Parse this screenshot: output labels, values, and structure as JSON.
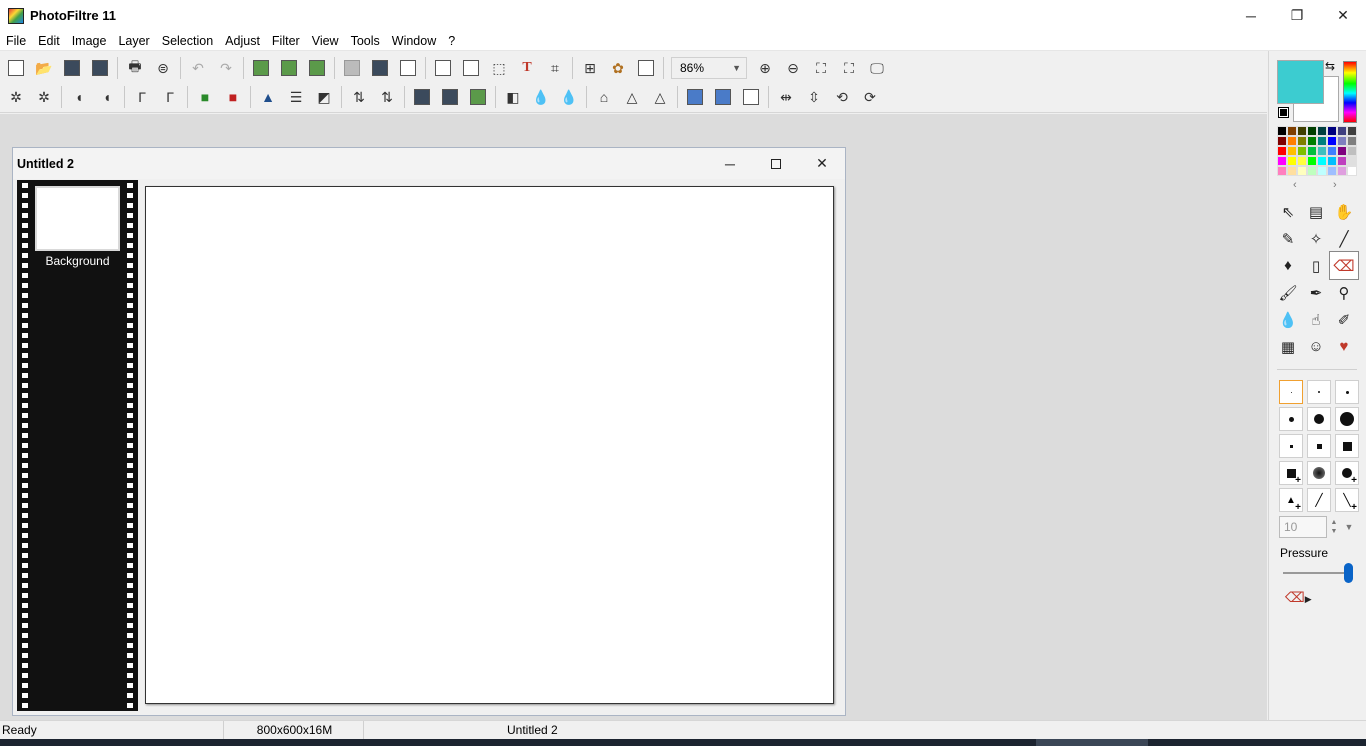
{
  "app": {
    "title": "PhotoFiltre 11"
  },
  "window_controls": {
    "minimize": "─",
    "maximize": "❐",
    "close": "✕"
  },
  "menu": [
    "File",
    "Edit",
    "Image",
    "Layer",
    "Selection",
    "Adjust",
    "Filter",
    "View",
    "Tools",
    "Window",
    "?"
  ],
  "toolbar": {
    "zoom_value": "86%"
  },
  "document": {
    "title": "Untitled 2",
    "layers": [
      {
        "name": "Background"
      }
    ]
  },
  "colors": {
    "foreground": "#3cccd0",
    "background": "#ffffff",
    "accent": "#0a64c8"
  },
  "palette": [
    "#000000",
    "#7f3f00",
    "#3f3f00",
    "#003f00",
    "#003f3f",
    "#00007f",
    "#3f3f7f",
    "#3f3f3f",
    "#7f0000",
    "#ff7f00",
    "#7f7f00",
    "#007f00",
    "#007f7f",
    "#0000ff",
    "#7f7fbf",
    "#7f7f7f",
    "#ff0000",
    "#ffbf00",
    "#7fbf00",
    "#00bf3f",
    "#3fbfbf",
    "#3f7fff",
    "#7f007f",
    "#bfbfbf",
    "#ff00ff",
    "#ffff00",
    "#ffff3f",
    "#00ff00",
    "#00ffff",
    "#00bfff",
    "#bf3fbf",
    "#dfdfdf",
    "#ff7fbf",
    "#ffdf9f",
    "#ffffbf",
    "#bfffbf",
    "#bfffff",
    "#9fbfff",
    "#df9fdf",
    "#ffffff"
  ],
  "tools_panel": {
    "brush_size": "10",
    "pressure_label": "Pressure",
    "pressure_level": 0.95
  },
  "status": {
    "ready": "Ready",
    "image_info": "800x600x16M",
    "doc_name": "Untitled 2"
  }
}
